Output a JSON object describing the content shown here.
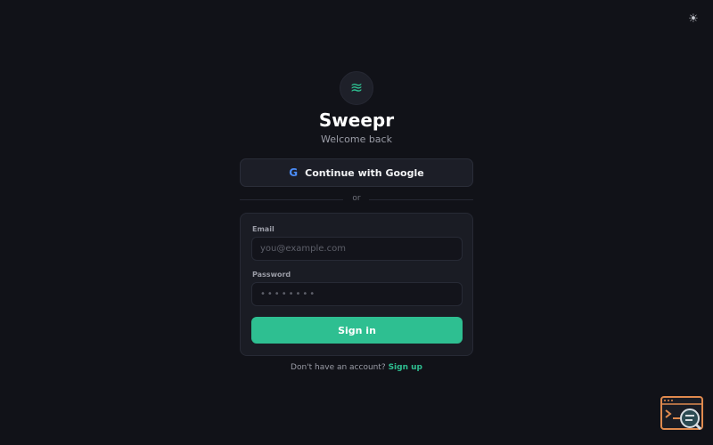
{
  "header": {
    "theme_toggle_icon": "sun-icon"
  },
  "brand": {
    "logo_icon": "waves-icon",
    "logo_glyph": "≋",
    "name": "Sweepr",
    "subtitle": "Welcome back"
  },
  "oauth": {
    "google_icon": "G",
    "google_label": "Continue with Google"
  },
  "divider": {
    "text": "or"
  },
  "form": {
    "email_label": "Email",
    "email_placeholder": "you@example.com",
    "email_value": "",
    "password_label": "Password",
    "password_placeholder": "••••••••",
    "password_value": "",
    "submit_label": "Sign in"
  },
  "footer": {
    "prompt": "Don't have an account?",
    "signup_label": "Sign up"
  },
  "corner_widget": {
    "icon": "code-search-icon"
  },
  "colors": {
    "background": "#111218",
    "card": "#1a1c24",
    "accent": "#2ebf91",
    "google_blue": "#4b8df8",
    "widget_orange": "#e08a4e"
  }
}
